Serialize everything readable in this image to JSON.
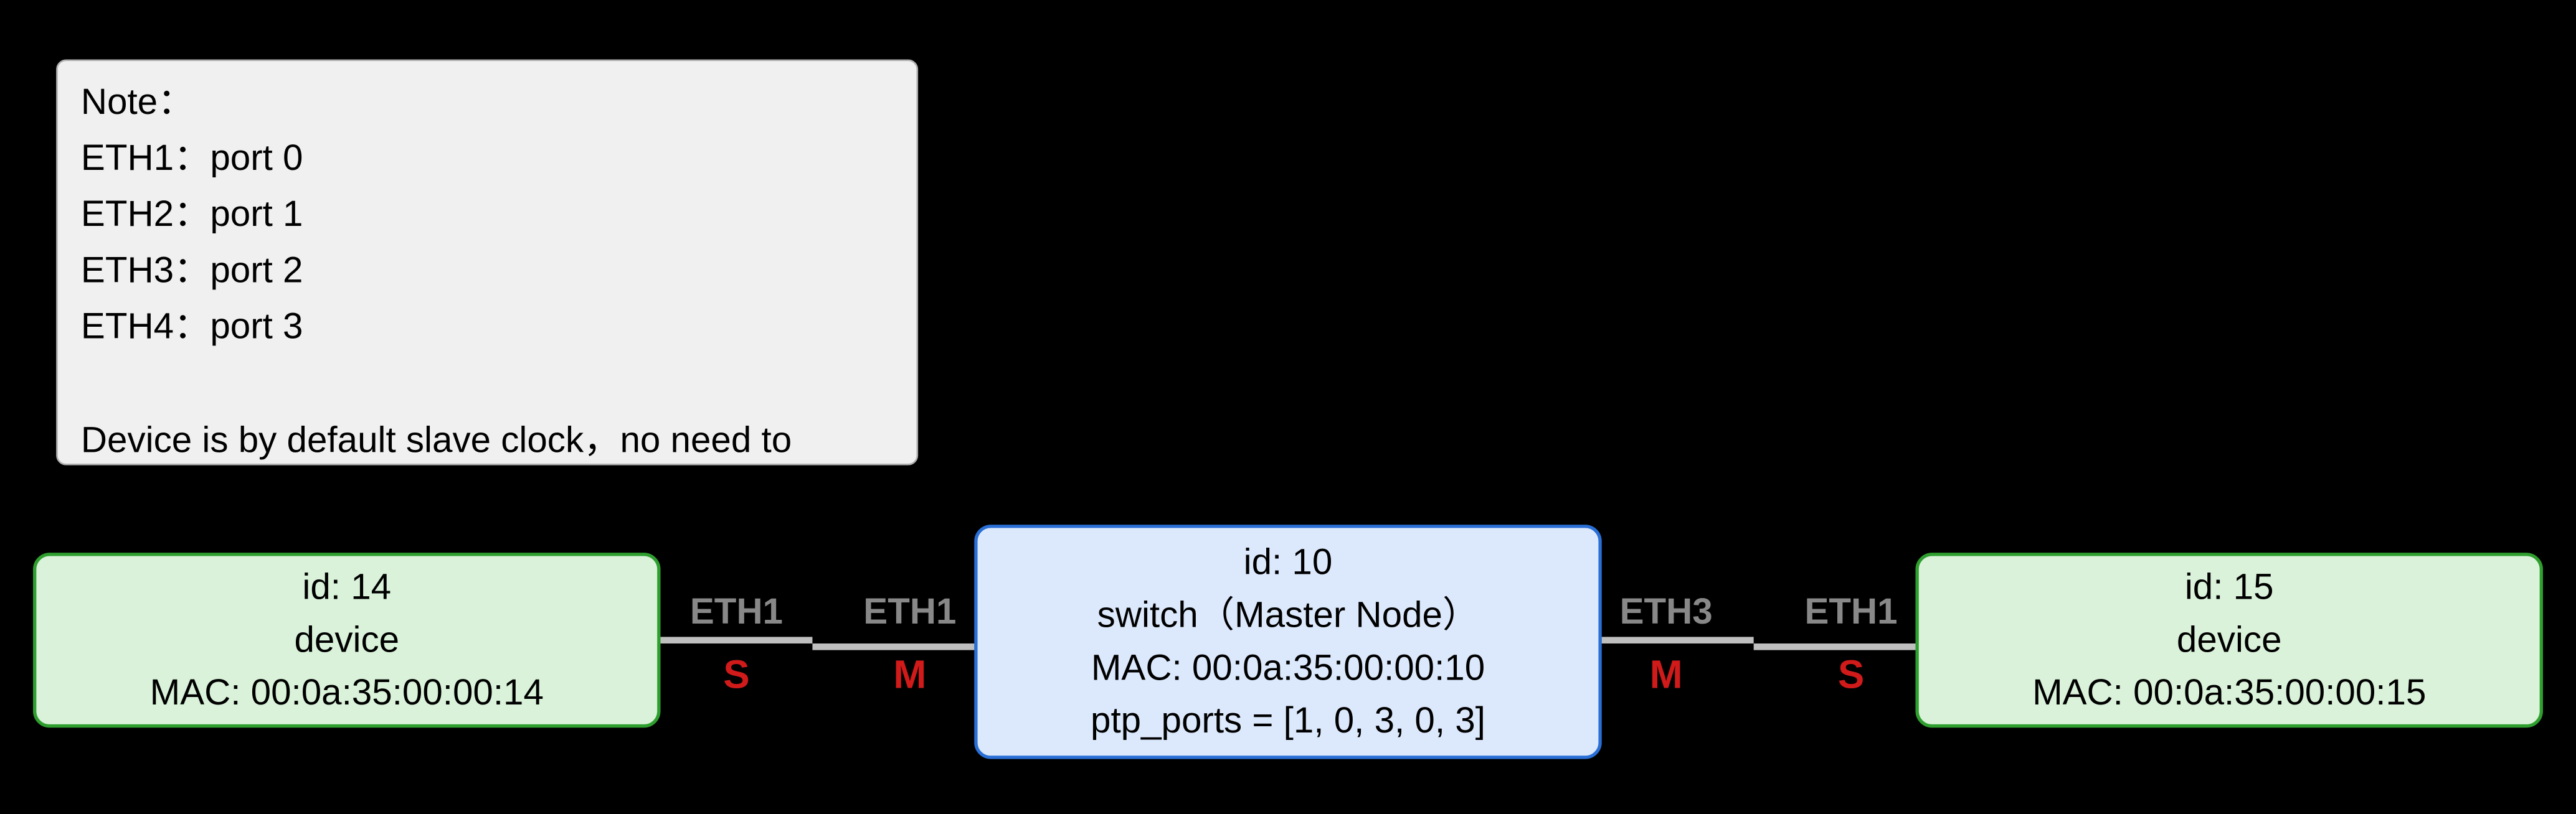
{
  "note": {
    "title": "Note：",
    "lines": [
      "ETH1：port 0",
      "ETH2：port 1",
      "ETH3：port 2",
      "ETH4：port 3"
    ],
    "footer": "Device is by default slave clock，no need to"
  },
  "nodes": {
    "left_device": {
      "id_line": "id: 14",
      "type_line": "device",
      "mac_line": "MAC: 00:0a:35:00:00:14"
    },
    "switch": {
      "id_line": "id: 10",
      "type_line": "switch（Master Node）",
      "mac_line": "MAC: 00:0a:35:00:00:10",
      "ptp_line": "ptp_ports = [1, 0, 3, 0, 3]"
    },
    "right_device": {
      "id_line": "id: 15",
      "type_line": "device",
      "mac_line": "MAC: 00:0a:35:00:00:15"
    }
  },
  "links": {
    "left": {
      "end_a_eth": "ETH1",
      "end_a_ms": "S",
      "end_b_eth": "ETH1",
      "end_b_ms": "M"
    },
    "right": {
      "end_a_eth": "ETH3",
      "end_a_ms": "M",
      "end_b_eth": "ETH1",
      "end_b_ms": "S"
    }
  }
}
